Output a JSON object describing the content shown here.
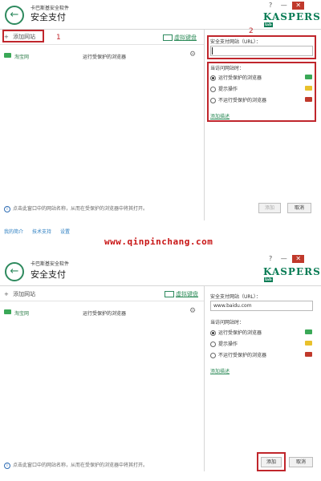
{
  "app": {
    "subtitle": "卡巴斯基安全软件",
    "title": "安全支付",
    "logo": "KASPERSKY",
    "logo_badge": "lab",
    "help_glyph": "?",
    "minimize_glyph": "—",
    "close_glyph": "✕"
  },
  "toolbar": {
    "add_site": "添加网站",
    "virtual_keyboard": "虚拟键盘"
  },
  "sites": [
    {
      "name": "淘宝网",
      "action": "运行受保护的浏览器"
    }
  ],
  "right_panel": {
    "url_label": "安全支付网站（URL）：",
    "url_value_panel1": "",
    "url_value_panel2": "www.baidu.com",
    "when_label": "当访问网站时：",
    "options": [
      {
        "label": "运行受保护的浏览器",
        "selected": true,
        "badge_color": "#3aa857"
      },
      {
        "label": "提示操作",
        "selected": false,
        "badge_color": "#e9c12c"
      },
      {
        "label": "不运行受保护的浏览器",
        "selected": false,
        "badge_color": "#c0392b"
      }
    ],
    "add_desc": "添加描述"
  },
  "footer": {
    "hint": "点击此窗口中的网站名称，从而在受保护的浏览器中将其打开。",
    "add_button": "添加",
    "cancel_button": "取消"
  },
  "bottom_links": [
    "我的简介",
    "技术支持",
    "设置"
  ],
  "annotations": {
    "num1": "1",
    "num2": "2"
  },
  "watermark": "www.qinpinchang.com",
  "colors": {
    "brand": "#0a7c55",
    "annotation": "#c0262c",
    "watermark": "#c81414"
  }
}
